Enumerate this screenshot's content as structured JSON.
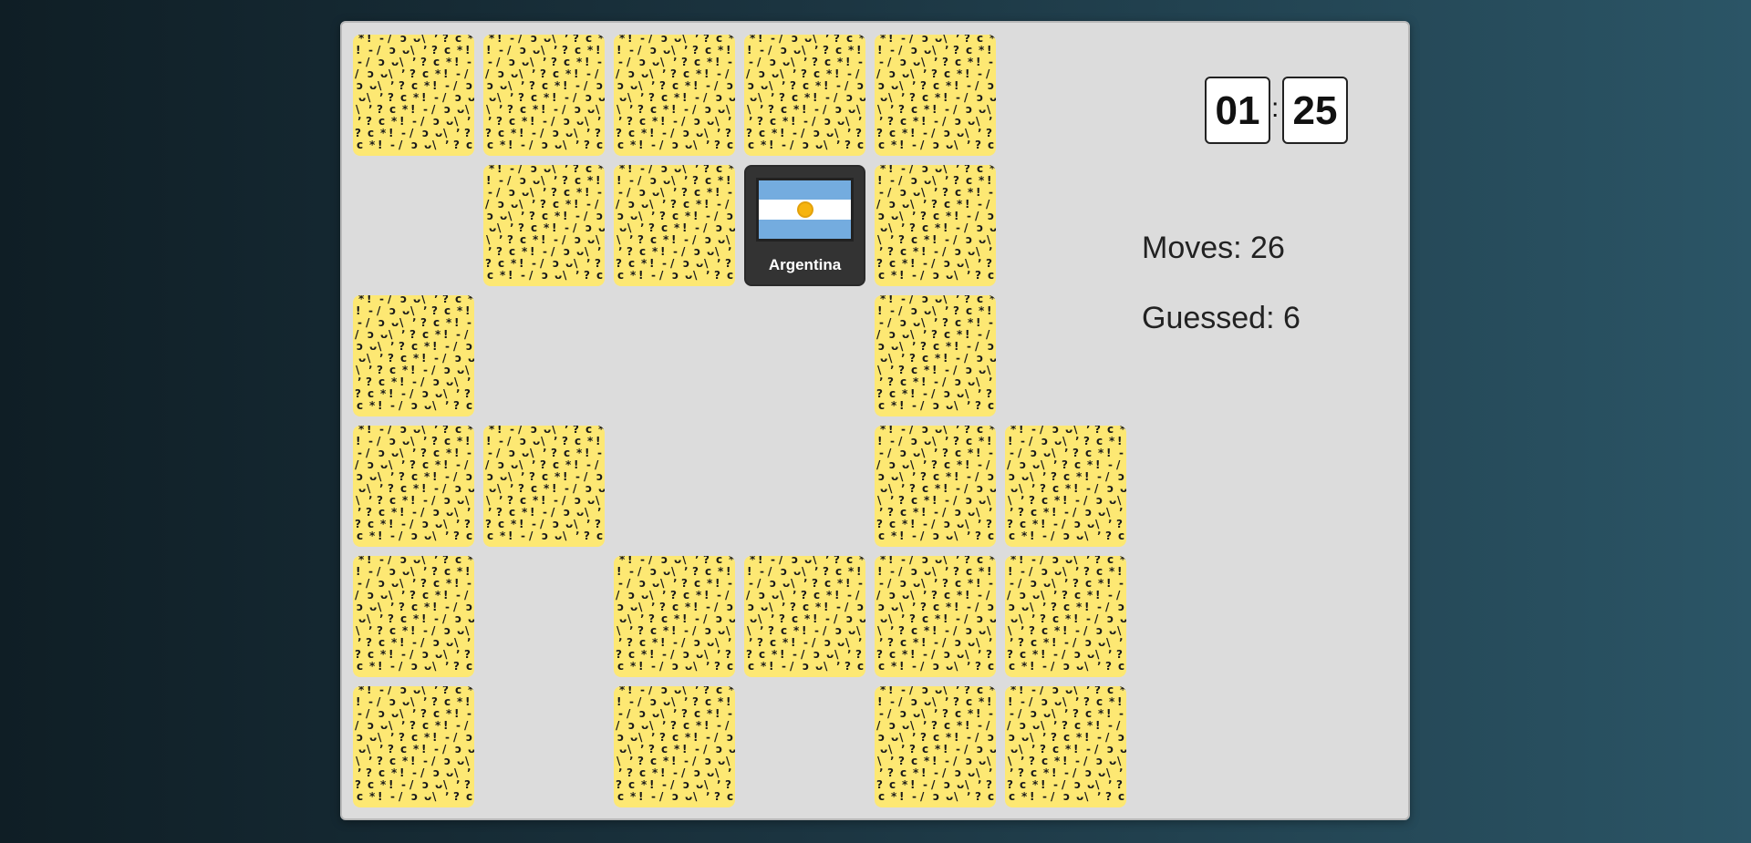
{
  "timer": {
    "minutes": "01",
    "separator": ":",
    "seconds": "25"
  },
  "stats": {
    "moves": "Moves: 26",
    "guessed": "Guessed: 6"
  },
  "colors": {
    "card_back": "#fde873",
    "board": "#dcdcdc",
    "face_card": "#333333"
  },
  "cards": [
    {
      "row": 0,
      "col": 0,
      "state": "hidden"
    },
    {
      "row": 0,
      "col": 1,
      "state": "hidden"
    },
    {
      "row": 0,
      "col": 2,
      "state": "hidden"
    },
    {
      "row": 0,
      "col": 3,
      "state": "hidden"
    },
    {
      "row": 0,
      "col": 4,
      "state": "hidden"
    },
    {
      "row": 1,
      "col": 1,
      "state": "hidden"
    },
    {
      "row": 1,
      "col": 2,
      "state": "hidden"
    },
    {
      "row": 1,
      "col": 3,
      "state": "revealed",
      "label": "Argentina",
      "icon": "argentina-flag-icon"
    },
    {
      "row": 1,
      "col": 4,
      "state": "hidden"
    },
    {
      "row": 2,
      "col": 0,
      "state": "hidden"
    },
    {
      "row": 2,
      "col": 4,
      "state": "hidden"
    },
    {
      "row": 3,
      "col": 0,
      "state": "hidden"
    },
    {
      "row": 3,
      "col": 1,
      "state": "hidden"
    },
    {
      "row": 3,
      "col": 4,
      "state": "hidden"
    },
    {
      "row": 3,
      "col": 5,
      "state": "hidden"
    },
    {
      "row": 4,
      "col": 0,
      "state": "hidden"
    },
    {
      "row": 4,
      "col": 2,
      "state": "hidden"
    },
    {
      "row": 4,
      "col": 3,
      "state": "hidden"
    },
    {
      "row": 4,
      "col": 4,
      "state": "hidden"
    },
    {
      "row": 4,
      "col": 5,
      "state": "hidden"
    },
    {
      "row": 5,
      "col": 0,
      "state": "hidden"
    },
    {
      "row": 5,
      "col": 2,
      "state": "hidden"
    },
    {
      "row": 5,
      "col": 4,
      "state": "hidden"
    },
    {
      "row": 5,
      "col": 5,
      "state": "hidden"
    }
  ]
}
